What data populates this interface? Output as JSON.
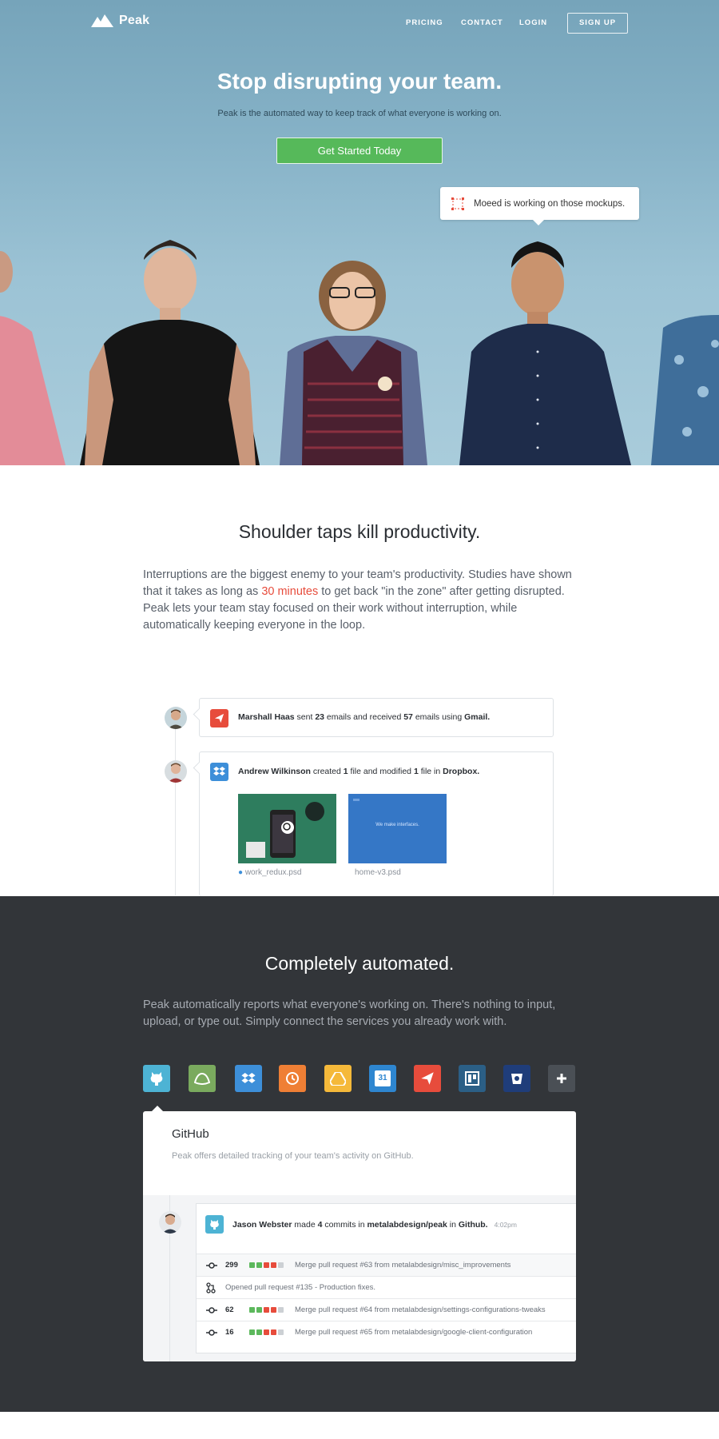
{
  "nav": {
    "logo_text": "Peak",
    "links": [
      "PRICING",
      "CONTACT",
      "LOGIN"
    ],
    "signup": "SIGN UP"
  },
  "hero": {
    "title": "Stop disrupting your team.",
    "subtitle": "Peak is the automated way to keep track of what everyone is working on.",
    "cta": "Get Started Today",
    "bubble_text": "Moeed is working on those mockups."
  },
  "section2": {
    "title": "Shoulder taps kill productivity.",
    "text_before": "Interruptions are the biggest enemy to your team's productivity. Studies have shown that it takes as long as ",
    "highlight": "30 minutes",
    "text_after": " to get back \"in the zone\" after getting disrupted. Peak lets your team stay focused on their work without interruption, while automatically keeping everyone in the loop.",
    "feed": [
      {
        "user": "Marshall Haas",
        "a1": " sent ",
        "n1": "23",
        "a2": " emails and received ",
        "n2": "57",
        "a3": " emails using ",
        "service": "Gmail."
      },
      {
        "user": "Andrew Wilkinson",
        "a1": " created ",
        "n1": "1",
        "a2": " file and modified ",
        "n2": "1",
        "a3": " file in ",
        "service": "Dropbox.",
        "files": [
          "work_redux.psd",
          "home-v3.psd"
        ],
        "thumb2_caption": "We make interfaces."
      }
    ]
  },
  "section3": {
    "title": "Completely automated.",
    "text": "Peak automatically reports what everyone's working on. There's nothing to input, upload, or type out. Simply connect the services you already work with.",
    "integrations": [
      "github-icon",
      "basecamp-icon",
      "dropbox-icon",
      "clock-icon",
      "google-drive-icon",
      "calendar-icon",
      "send-icon",
      "trello-icon",
      "bucket-icon",
      "plus-icon"
    ],
    "calendar_day": "31",
    "panel": {
      "title": "GitHub",
      "desc": "Peak offers detailed tracking of your team's activity on GitHub.",
      "activity": {
        "user": "Jason Webster",
        "a1": " made ",
        "n1": "4",
        "a2": " commits in ",
        "repo": "metalabdesign/peak",
        "a3": " in ",
        "service": "Github.",
        "time": "4:02pm"
      },
      "rows": [
        {
          "num": "299",
          "text": "Merge pull request #63 from metalabdesign/misc_improvements"
        },
        {
          "num": "",
          "text": "Opened pull request #135 - Production fixes."
        },
        {
          "num": "62",
          "text": "Merge pull request #64 from metalabdesign/settings-configurations-tweaks"
        },
        {
          "num": "16",
          "text": "Merge pull request #65 from metalabdesign/google-client-configuration"
        }
      ]
    }
  },
  "colors": {
    "accent_green": "#56b95a",
    "highlight_red": "#e74c3c",
    "dark_bg": "#323539"
  }
}
